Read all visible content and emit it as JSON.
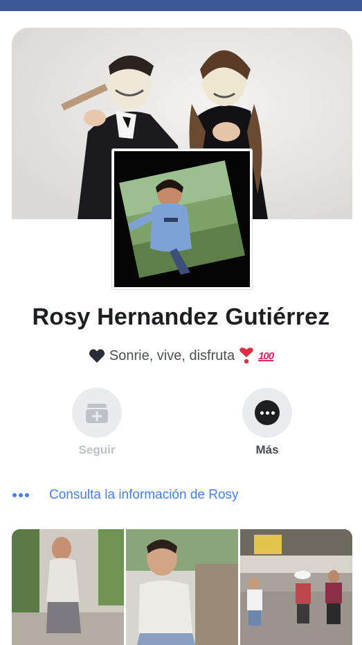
{
  "profile": {
    "name": "Rosy Hernandez Gutiérrez",
    "bio_text": "Sonrie, vive, disfruta",
    "bio_badge": "100"
  },
  "actions": {
    "follow_label": "Seguir",
    "more_label": "Más"
  },
  "info_link": {
    "text": "Consulta la información de Rosy"
  },
  "icons": {
    "bio_start": "black-heart-icon",
    "bio_end_1": "red-heart-exclamation-icon",
    "bio_end_2": "hundred-points-icon",
    "follow": "follow-box-plus-icon",
    "more": "more-dots-icon",
    "info": "dots-icon"
  },
  "colors": {
    "top_bar": "#3b5998",
    "link": "#4080ff",
    "disabled": "#bec3c9",
    "action_bg": "#e9ebee"
  }
}
